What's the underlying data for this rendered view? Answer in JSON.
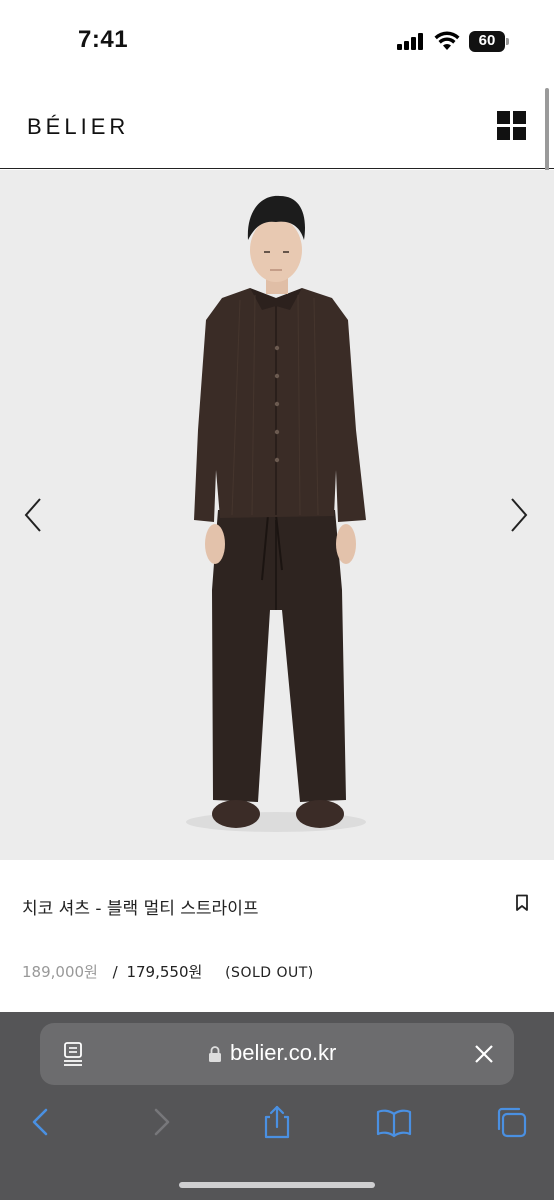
{
  "status_bar": {
    "time": "7:41",
    "battery": "60"
  },
  "header": {
    "logo": "BÉLIER",
    "menu_icon": "grid-menu-icon"
  },
  "product": {
    "image_alt": "Model wearing dark brown multi-stripe shirt and trousers",
    "title": "치코 셔츠 - 블랙 멀티 스트라이프",
    "price_original": "189,000원",
    "price_separator": "/",
    "price_sale": "179,550원",
    "status": "(SOLD OUT)"
  },
  "carousel": {
    "prev_icon": "chevron-left-icon",
    "next_icon": "chevron-right-icon"
  },
  "browser": {
    "url": "belier.co.kr",
    "accent_color": "#4a90e2",
    "toolbar": [
      "back-icon",
      "forward-icon",
      "share-icon",
      "bookmarks-icon",
      "tabs-icon"
    ]
  }
}
